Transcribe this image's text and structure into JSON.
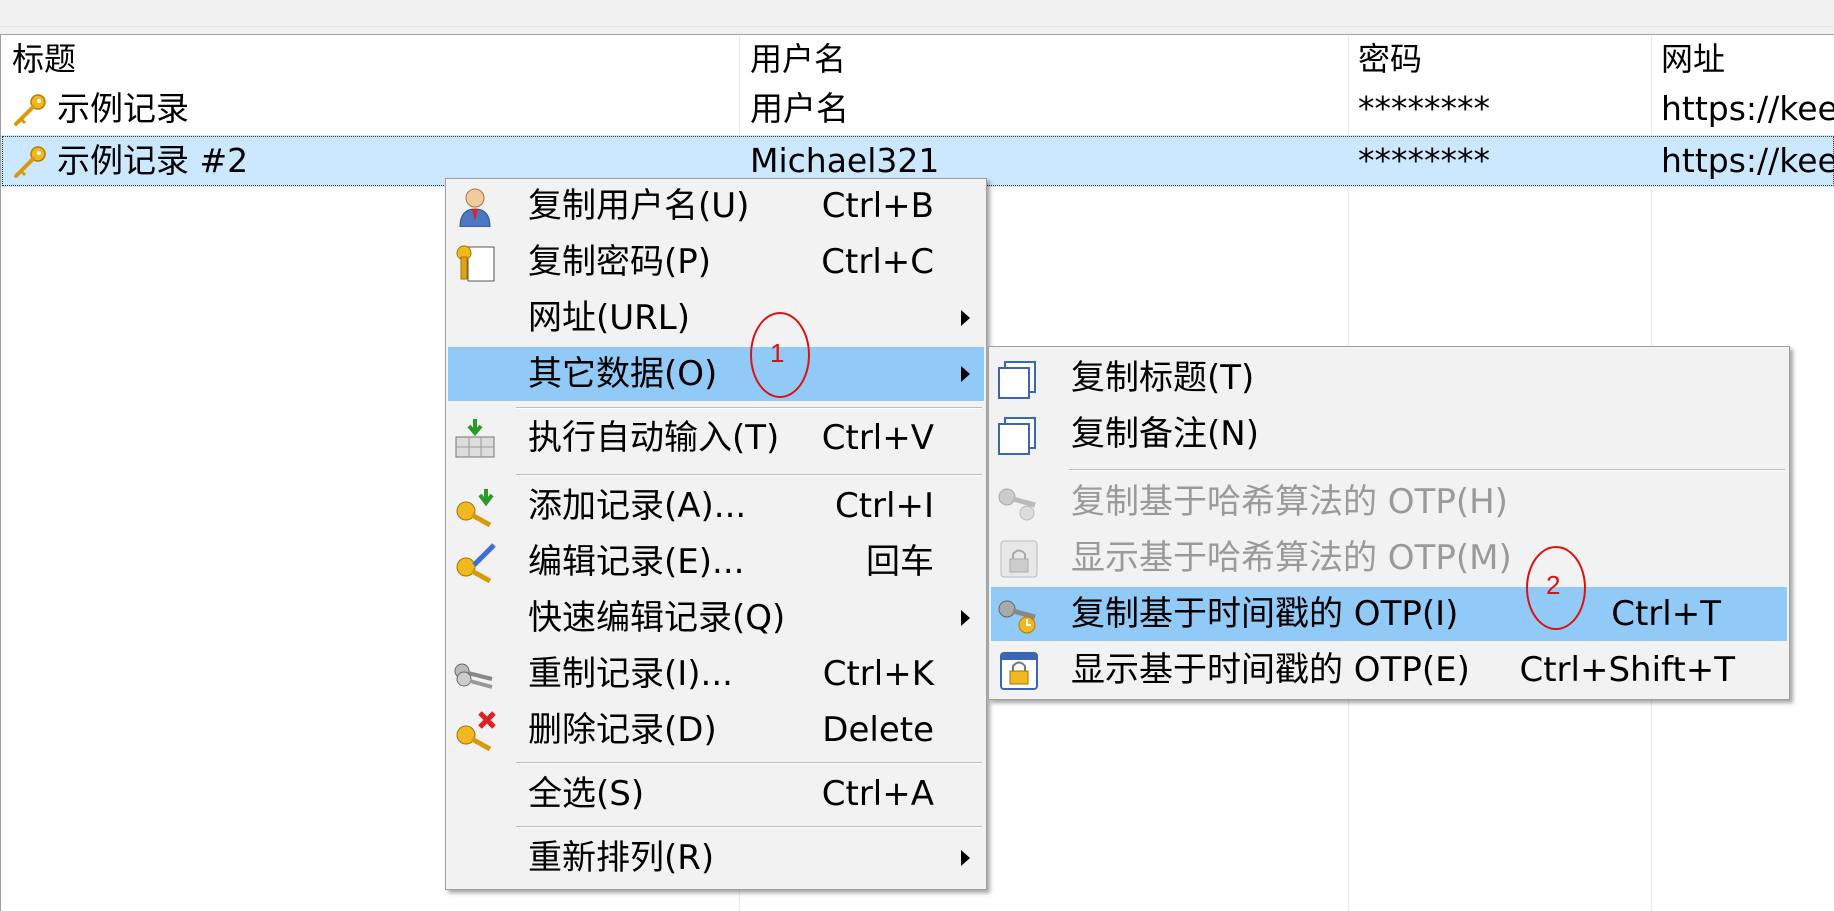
{
  "table": {
    "columns": [
      "标题",
      "用户名",
      "密码",
      "网址"
    ],
    "rows": [
      {
        "title": "示例记录",
        "username": "用户名",
        "password": "********",
        "url": "https://kee"
      },
      {
        "title": "示例记录 #2",
        "username": "Michael321",
        "password": "********",
        "url": "https://kee"
      }
    ]
  },
  "context_menu": {
    "items": [
      {
        "label": "复制用户名(U)",
        "shortcut": "Ctrl+B",
        "icon": "user-icon"
      },
      {
        "label": "复制密码(P)",
        "shortcut": "Ctrl+C",
        "icon": "key-card-icon"
      },
      {
        "label": "网址(URL)",
        "submenu": true
      },
      {
        "label": "其它数据(O)",
        "submenu": true,
        "highlighted": true
      },
      {
        "label": "执行自动输入(T)",
        "shortcut": "Ctrl+V",
        "icon": "auto-type-icon"
      },
      {
        "label": "添加记录(A)...",
        "shortcut": "Ctrl+I",
        "icon": "add-key-icon"
      },
      {
        "label": "编辑记录(E)...",
        "shortcut": "回车",
        "icon": "edit-key-icon"
      },
      {
        "label": "快速编辑记录(Q)",
        "submenu": true
      },
      {
        "label": "重制记录(I)...",
        "shortcut": "Ctrl+K",
        "icon": "duplicate-key-icon"
      },
      {
        "label": "删除记录(D)",
        "shortcut": "Delete",
        "icon": "delete-key-icon"
      },
      {
        "label": "全选(S)",
        "shortcut": "Ctrl+A"
      },
      {
        "label": "重新排列(R)",
        "submenu": true
      }
    ]
  },
  "sub_menu": {
    "items": [
      {
        "label": "复制标题(T)",
        "icon": "copy-icon"
      },
      {
        "label": "复制备注(N)",
        "icon": "copy-icon"
      },
      {
        "label": "复制基于哈希算法的 OTP(H)",
        "icon": "otp-key-icon",
        "disabled": true
      },
      {
        "label": "显示基于哈希算法的 OTP(M)",
        "icon": "lock-window-icon",
        "disabled": true
      },
      {
        "label": "复制基于时间戳的 OTP(I)",
        "shortcut": "Ctrl+T",
        "icon": "otp-time-key-icon",
        "highlighted": true
      },
      {
        "label": "显示基于时间戳的 OTP(E)",
        "shortcut": "Ctrl+Shift+T",
        "icon": "lock-window-icon"
      }
    ]
  },
  "annotations": [
    "1",
    "2"
  ],
  "colors": {
    "selection": "#cce8ff",
    "menu_highlight": "#91c9f7",
    "annotation": "#dd1111"
  }
}
